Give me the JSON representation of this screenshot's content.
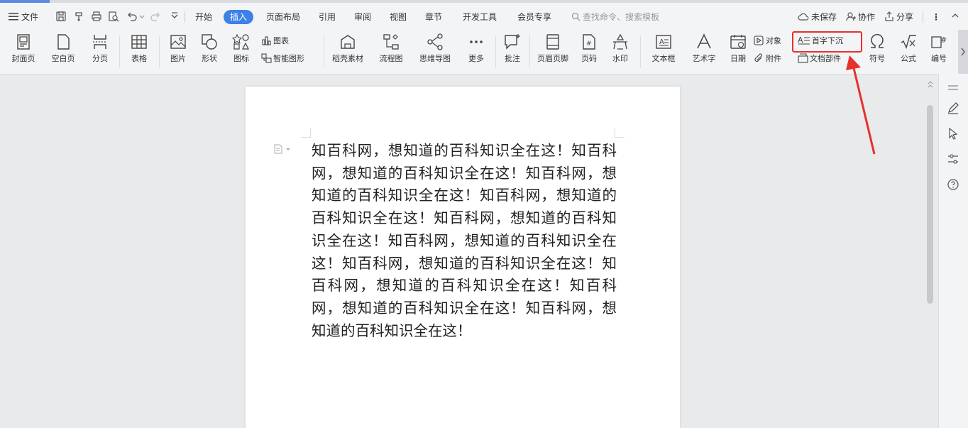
{
  "menubar": {
    "file_label": "文件",
    "tabs": [
      "开始",
      "插入",
      "页面布局",
      "引用",
      "审阅",
      "视图",
      "章节",
      "开发工具",
      "会员专享"
    ],
    "active_tab": "插入",
    "search_placeholder": "查找命令、搜索模板",
    "unsaved_label": "未保存",
    "collab_label": "协作",
    "share_label": "分享"
  },
  "ribbon": {
    "cover_page": "封面页",
    "blank_page": "空白页",
    "page_break": "分页",
    "table": "表格",
    "picture": "图片",
    "shape": "形状",
    "icon": "图标",
    "chart": "图表",
    "smart_art": "智能图形",
    "daoke_material": "稻壳素材",
    "flowchart": "流程图",
    "mindmap": "思维导图",
    "more": "更多",
    "comment": "批注",
    "header_footer": "页眉页脚",
    "page_number": "页码",
    "watermark": "水印",
    "text_box": "文本框",
    "word_art": "艺术字",
    "date": "日期",
    "object": "对象",
    "attachment": "附件",
    "drop_cap": "首字下沉",
    "doc_parts": "文档部件",
    "symbol": "符号",
    "formula": "公式",
    "numbering": "编号"
  },
  "document": {
    "body_text": "知百科网，想知道的百科知识全在这！知百科网，想知道的百科知识全在这！知百科网，想知道的百科知识全在这！知百科网，想知道的百科知识全在这！知百科网，想知道的百科知识全在这！知百科网，想知道的百科知识全在这！知百科网，想知道的百科知识全在这！知百科网，想知道的百科知识全在这！知百科网，想知道的百科知识全在这！知百科网，想知道的百科知识全在这！"
  },
  "colors": {
    "accent": "#3d80e6",
    "highlight": "#e8302c"
  }
}
